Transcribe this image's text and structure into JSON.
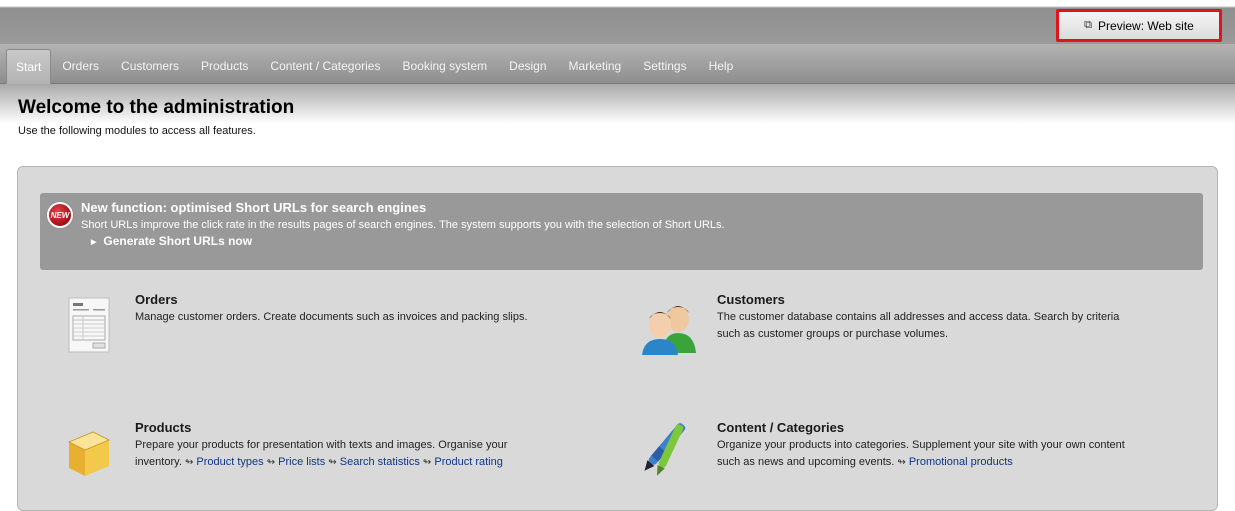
{
  "header": {
    "preview_label": "Preview: Web site",
    "preview_icon": "external-link-icon"
  },
  "nav": {
    "tabs": [
      {
        "label": "Start",
        "active": true
      },
      {
        "label": "Orders"
      },
      {
        "label": "Customers"
      },
      {
        "label": "Products"
      },
      {
        "label": "Content / Categories"
      },
      {
        "label": "Booking system"
      },
      {
        "label": "Design"
      },
      {
        "label": "Marketing"
      },
      {
        "label": "Settings"
      },
      {
        "label": "Help"
      }
    ]
  },
  "page": {
    "title": "Welcome to the administration",
    "subtitle": "Use the following modules to access all features."
  },
  "notice": {
    "badge": "NEW",
    "title": "New function: optimised Short URLs for search engines",
    "text": "Short URLs improve the click rate in the results pages of search engines. The system supports you with the selection of Short URLs.",
    "link": "Generate Short URLs now"
  },
  "modules": {
    "orders": {
      "title": "Orders",
      "desc": "Manage customer orders. Create documents such as invoices and packing slips."
    },
    "customers": {
      "title": "Customers",
      "desc_line1": "The customer database contains all addresses and access data. Search by criteria",
      "desc_line2": "such as customer groups or purchase volumes."
    },
    "products": {
      "title": "Products",
      "desc_line1": "Prepare your products for presentation with texts and images. Organise your",
      "desc_line2": "inventory.",
      "links": [
        "Product types",
        "Price lists",
        "Search statistics",
        "Product rating"
      ]
    },
    "content": {
      "title": "Content / Categories",
      "desc_line1": "Organize your products into categories. Supplement your site with your own content",
      "desc_line2": "such as news and upcoming events.",
      "links": [
        "Promotional products"
      ]
    }
  },
  "colors": {
    "highlight": "#e0151b",
    "link": "#10358a",
    "notice_bg": "#999999"
  }
}
